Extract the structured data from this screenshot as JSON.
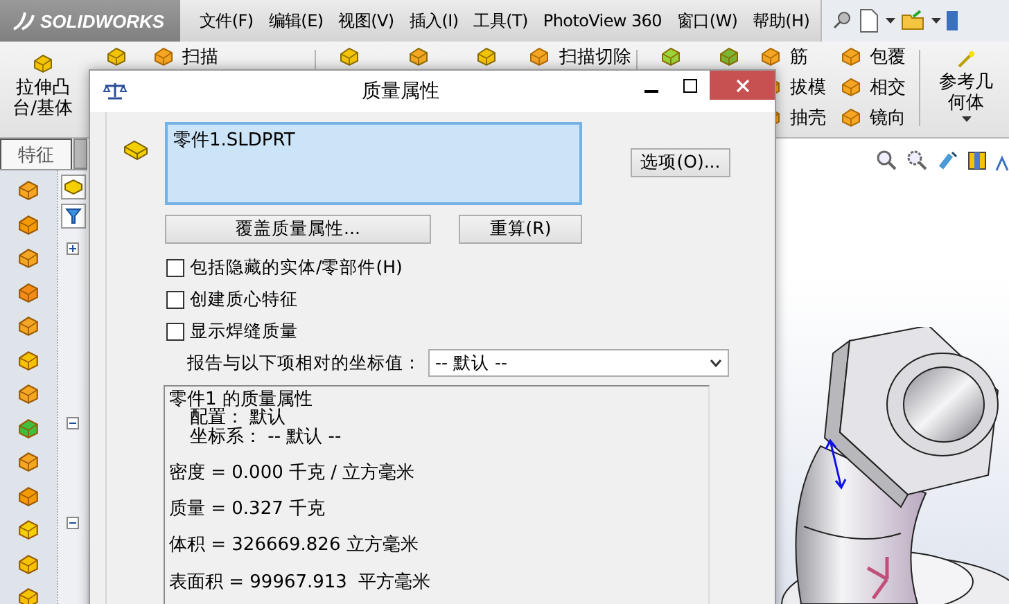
{
  "menu_bar": {
    "logo": "SOLIDWORKS",
    "items": [
      "文件(F)",
      "编辑(E)",
      "视图(V)",
      "插入(I)",
      "工具(T)",
      "PhotoView 360",
      "窗口(W)",
      "帮助(H)"
    ]
  },
  "ribbon": {
    "extrude": "拉伸凸台/基体",
    "columns": [
      [
        "扫描"
      ],
      [
        "扫描切除"
      ],
      [
        "筋",
        "拔模",
        "抽壳"
      ],
      [
        "包覆",
        "相交",
        "镜向"
      ]
    ],
    "reference": "参考几何体"
  },
  "left_panel": {
    "tabs": [
      {
        "label": "特征",
        "selected": true
      }
    ]
  },
  "dialog": {
    "title": "质量属性",
    "selection": "零件1.SLDPRT",
    "options_button": "选项(O)...",
    "override_button": "覆盖质量属性...",
    "recalc_button": "重算(R)",
    "checkboxes": [
      {
        "label": "包括隐藏的实体/零部件(H)",
        "checked": false
      },
      {
        "label": "创建质心特征",
        "checked": false
      },
      {
        "label": "显示焊缝质量",
        "checked": false
      }
    ],
    "coord_label": "报告与以下项相对的坐标值：",
    "coord_value": "-- 默认 --",
    "report": {
      "title": "零件1 的质量属性",
      "details": [
        "配置： 默认",
        "坐标系： -- 默认 --"
      ],
      "values": [
        "密度 = 0.000 千克 / 立方毫米",
        "质量 = 0.327 千克",
        "体积 = 326669.826 立方毫米",
        "表面积 = 99967.913  平方毫米"
      ]
    }
  }
}
